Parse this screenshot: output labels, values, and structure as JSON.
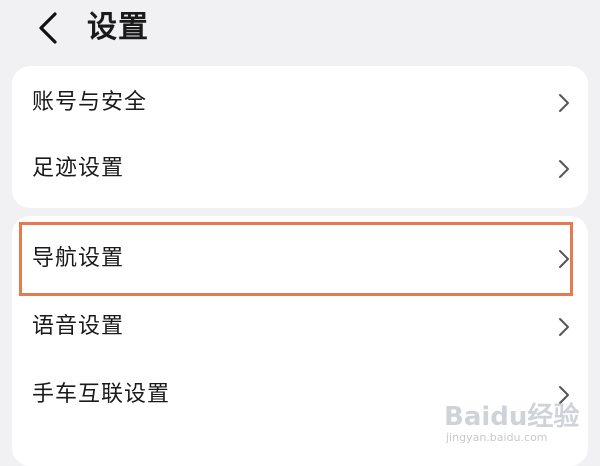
{
  "header": {
    "title": "设置",
    "back_icon": "chevron-left-icon"
  },
  "groups": [
    {
      "items": [
        {
          "label": "账号与安全",
          "icon": "chevron-right-icon"
        },
        {
          "label": "足迹设置",
          "icon": "chevron-right-icon"
        }
      ]
    },
    {
      "items": [
        {
          "label": "导航设置",
          "icon": "chevron-right-icon",
          "highlighted": true
        },
        {
          "label": "语音设置",
          "icon": "chevron-right-icon"
        },
        {
          "label": "手车互联设置",
          "icon": "chevron-right-icon"
        }
      ]
    }
  ],
  "highlight_color": "#e47a4d",
  "watermark": {
    "logo": "Baidu经验",
    "url": "jingyan.baidu.com"
  }
}
